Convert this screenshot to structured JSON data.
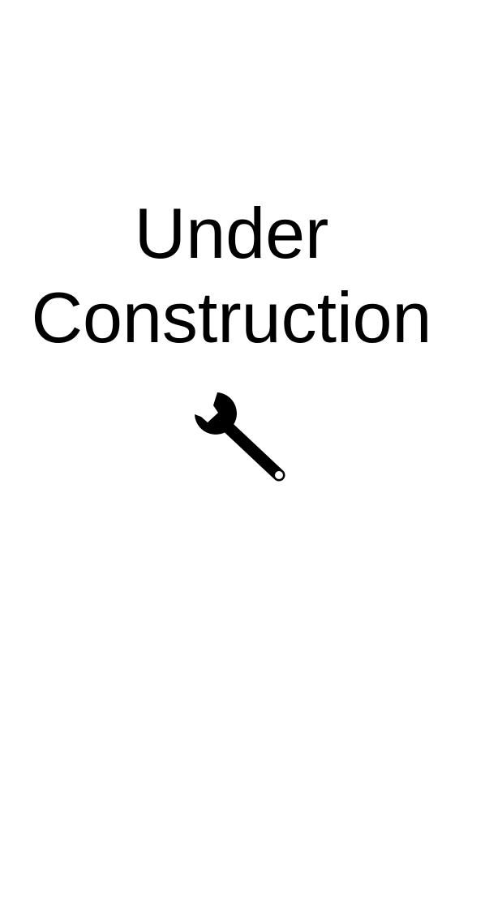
{
  "page": {
    "title_line_1": "Under",
    "title_line_2": "Construction",
    "icon": "wrench-icon",
    "text_color": "#000000",
    "background_color": "#ffffff"
  }
}
